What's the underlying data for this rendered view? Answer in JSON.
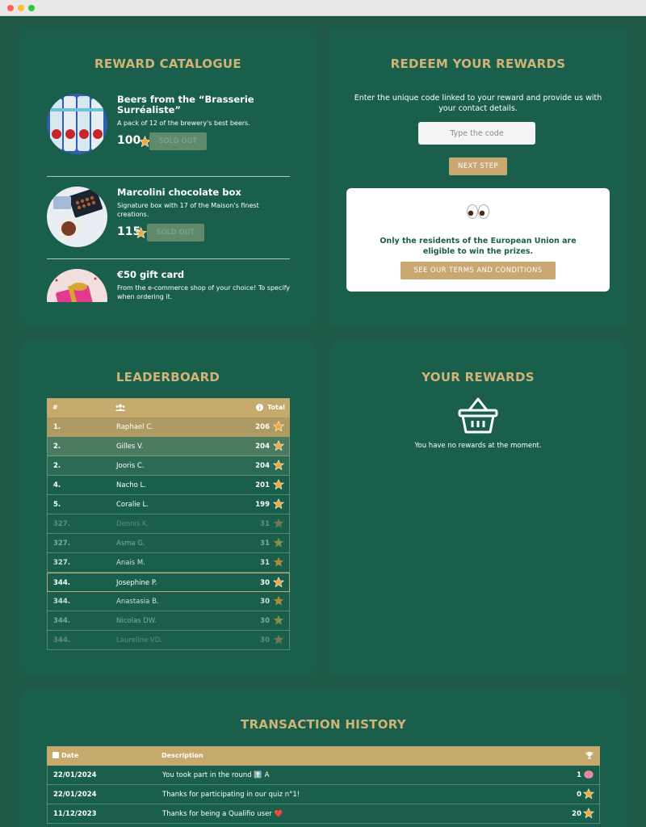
{
  "catalogue": {
    "title": "REWARD CATALOGUE",
    "items": [
      {
        "name": "Beers from the “Brasserie Surréaliste”",
        "description": "A pack of 12 of the brewery's best beers.",
        "price": "100",
        "button": "SOLD OUT",
        "image_icon": "beer-cans"
      },
      {
        "name": "Marcolini chocolate box",
        "description": "Signature box with 17 of the Maison's finest creations.",
        "price": "115",
        "button": "SOLD OUT",
        "image_icon": "chocolate-box"
      },
      {
        "name": "€50 gift card",
        "description": "From the e-commerce shop of your choice! To specify when ordering it.",
        "price": "",
        "button": "",
        "image_icon": "gift-box"
      }
    ]
  },
  "redeem": {
    "title": "REDEEM YOUR REWARDS",
    "instructions": "Enter the unique code linked to your reward and provide us with your contact details.",
    "code_placeholder": "Type the code",
    "next_label": "NEXT STEP",
    "notice_icon": "eyes-emoji",
    "notice_text": "Only the residents of the European Union are eligible to win the prizes.",
    "terms_label": "SEE OUR TERMS AND CONDITIONS"
  },
  "leaderboard": {
    "title": "LEADERBOARD",
    "headers": {
      "rank": "#",
      "players_icon": "users-icon",
      "info_icon": "info-icon",
      "total": "Total"
    },
    "rows": [
      {
        "rank": "1.",
        "name": "Raphael C.",
        "total": "206"
      },
      {
        "rank": "2.",
        "name": "Gilles V.",
        "total": "204"
      },
      {
        "rank": "2.",
        "name": "Jooris C.",
        "total": "204"
      },
      {
        "rank": "4.",
        "name": "Nacho L.",
        "total": "201"
      },
      {
        "rank": "5.",
        "name": "Coralie L.",
        "total": "199"
      },
      {
        "rank": "327.",
        "name": "Dennis K.",
        "total": "31"
      },
      {
        "rank": "327.",
        "name": "Asma G.",
        "total": "31"
      },
      {
        "rank": "327.",
        "name": "Anais M.",
        "total": "31"
      },
      {
        "rank": "344.",
        "name": "Josephine P.",
        "total": "30"
      },
      {
        "rank": "344.",
        "name": "Anastasia B.",
        "total": "30"
      },
      {
        "rank": "344.",
        "name": "Nicolas DW.",
        "total": "30"
      },
      {
        "rank": "344.",
        "name": "Laureline VD.",
        "total": "30"
      }
    ]
  },
  "your_rewards": {
    "title": "YOUR REWARDS",
    "icon": "basket-icon",
    "empty_text": "You have no rewards at the moment."
  },
  "history": {
    "title": "TRANSACTION HISTORY",
    "headers": {
      "date": "Date",
      "description": "Description",
      "points_icon": "trophy-icon"
    },
    "rows": [
      {
        "date": "22/01/2024",
        "description": "You took part in the round ⬆️ A",
        "points": "1",
        "icon": "brain-icon"
      },
      {
        "date": "22/01/2024",
        "description": "Thanks for participating in our quiz n°1!",
        "points": "0",
        "icon": "star-icon"
      },
      {
        "date": "11/12/2023",
        "description": "Thanks for being a Qualifio user ❤️",
        "points": "20",
        "icon": "star-icon"
      }
    ]
  },
  "colors": {
    "background": "#1e5947",
    "card": "#195f4c",
    "accent_gold": "#c6a96d",
    "title_gold": "#d2b377",
    "star": "#f2a93b",
    "soldout": "#5f8a6c"
  }
}
